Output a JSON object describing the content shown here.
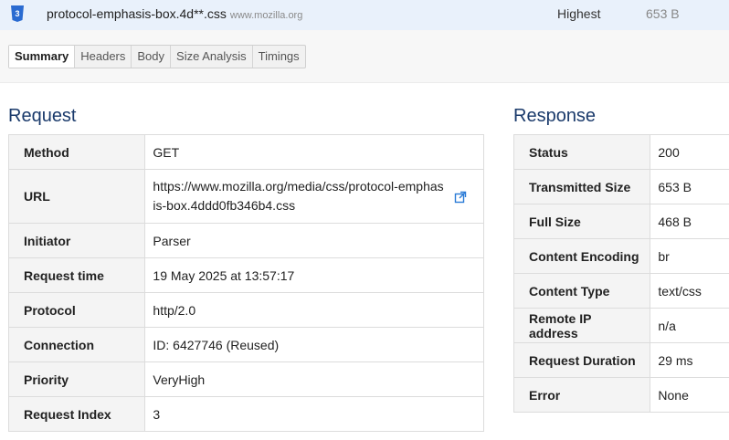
{
  "file_row": {
    "icon": "css-file-icon",
    "name": "protocol-emphasis-box.4d**.css",
    "domain": "www.mozilla.org",
    "priority": "Highest",
    "size": "653 B"
  },
  "tabs": [
    {
      "label": "Summary",
      "active": true
    },
    {
      "label": "Headers",
      "active": false
    },
    {
      "label": "Body",
      "active": false
    },
    {
      "label": "Size Analysis",
      "active": false
    },
    {
      "label": "Timings",
      "active": false
    }
  ],
  "request": {
    "title": "Request",
    "rows": [
      {
        "key": "Method",
        "value": "GET"
      },
      {
        "key": "URL",
        "value": "https://www.mozilla.org/media/css/protocol-emphasis-box.4ddd0fb346b4.css"
      },
      {
        "key": "Initiator",
        "value": "Parser"
      },
      {
        "key": "Request time",
        "value": "19 May 2025 at 13:57:17"
      },
      {
        "key": "Protocol",
        "value": "http/2.0"
      },
      {
        "key": "Connection",
        "value": "ID: 6427746 (Reused)"
      },
      {
        "key": "Priority",
        "value": "VeryHigh"
      },
      {
        "key": "Request Index",
        "value": "3"
      }
    ]
  },
  "response": {
    "title": "Response",
    "rows": [
      {
        "key": "Status",
        "value": "200"
      },
      {
        "key": "Transmitted Size",
        "value": "653 B"
      },
      {
        "key": "Full Size",
        "value": "468 B"
      },
      {
        "key": "Content Encoding",
        "value": "br"
      },
      {
        "key": "Content Type",
        "value": "text/css"
      },
      {
        "key": "Remote IP address",
        "value": "n/a"
      },
      {
        "key": "Request Duration",
        "value": "29 ms"
      },
      {
        "key": "Error",
        "value": "None"
      }
    ]
  },
  "colors": {
    "accent": "#1a3a6b",
    "row_highlight": "#e9f1fb",
    "css_icon": "#2a6bd1"
  }
}
